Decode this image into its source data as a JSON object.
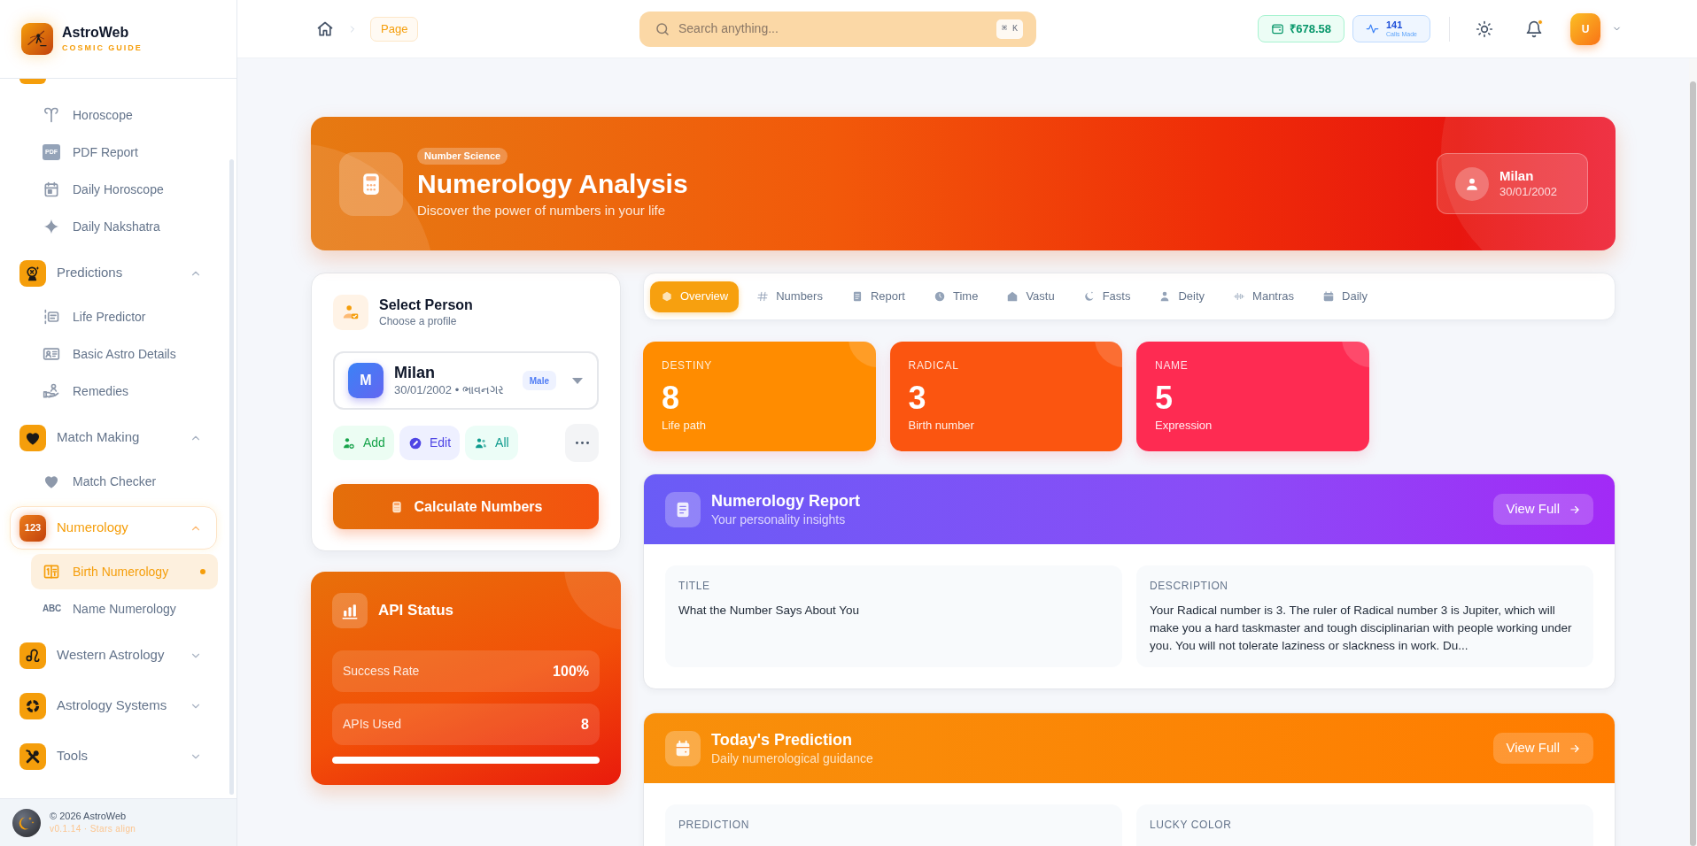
{
  "sidebar": {
    "brand": {
      "name": "AstroWeb",
      "tagline": "COSMIC GUIDE"
    },
    "groups": [
      {
        "children": [
          {
            "label": "Horoscope",
            "selected": false
          },
          {
            "label": "PDF Report",
            "icon_text": "PDF",
            "selected": false
          },
          {
            "label": "Daily Horoscope",
            "selected": false
          },
          {
            "label": "Daily Nakshatra",
            "selected": false
          }
        ]
      },
      {
        "label": "Predictions",
        "expanded": true,
        "selected": false,
        "children": [
          {
            "label": "Life Predictor",
            "selected": false
          },
          {
            "label": "Basic Astro Details",
            "selected": false
          },
          {
            "label": "Remedies",
            "selected": false
          }
        ]
      },
      {
        "label": "Match Making",
        "expanded": true,
        "selected": false,
        "children": [
          {
            "label": "Match Checker",
            "selected": false
          }
        ]
      },
      {
        "label": "Numerology",
        "icon_text": "123",
        "expanded": true,
        "selected": true,
        "children": [
          {
            "label": "Birth Numerology",
            "selected": true
          },
          {
            "label": "Name Numerology",
            "icon_text": "ABC",
            "selected": false
          }
        ]
      },
      {
        "label": "Western Astrology",
        "expanded": false,
        "selected": false
      },
      {
        "label": "Astrology Systems",
        "expanded": false,
        "selected": false
      },
      {
        "label": "Tools",
        "expanded": false,
        "selected": false
      }
    ],
    "footer": {
      "copyright": "© 2026 AstroWeb",
      "version": "v0.1.14 · Stars align"
    }
  },
  "topbar": {
    "breadcrumb": {
      "current": "Page"
    },
    "search": {
      "placeholder": "Search anything...",
      "shortcut": "⌘ K"
    },
    "wallet": {
      "balance": "₹678.58"
    },
    "calls": {
      "count": "141",
      "label": "Calls Made"
    },
    "notifications": {
      "unread": true
    },
    "user": {
      "initial": "U"
    }
  },
  "hero": {
    "badge": "Number Science",
    "title": "Numerology Analysis",
    "subtitle": "Discover the power of numbers in your life",
    "person": {
      "name": "Milan",
      "date": "30/01/2002"
    }
  },
  "select_person": {
    "title": "Select Person",
    "subtitle": "Choose a profile",
    "profile": {
      "initial": "M",
      "name": "Milan",
      "details": "30/01/2002 • ભાવનગર",
      "gender": "Male"
    },
    "actions": [
      {
        "kind": "add",
        "label": "Add"
      },
      {
        "kind": "edit",
        "label": "Edit"
      },
      {
        "kind": "all",
        "label": "All"
      }
    ],
    "primary_action": "Calculate Numbers"
  },
  "api_status": {
    "title": "API Status",
    "metrics": [
      {
        "label": "Success Rate",
        "value": "100%"
      },
      {
        "label": "APIs Used",
        "value": "8"
      }
    ],
    "level": 1
  },
  "tabs": [
    {
      "label": "Overview",
      "selected": true
    },
    {
      "label": "Numbers",
      "selected": false
    },
    {
      "label": "Report",
      "selected": false
    },
    {
      "label": "Time",
      "selected": false
    },
    {
      "label": "Vastu",
      "selected": false
    },
    {
      "label": "Fasts",
      "selected": false
    },
    {
      "label": "Deity",
      "selected": false
    },
    {
      "label": "Mantras",
      "selected": false
    },
    {
      "label": "Daily",
      "selected": false
    }
  ],
  "number_cards": [
    {
      "label": "DESTINY",
      "value": "8",
      "caption": "Life path",
      "color": "#ff8c00"
    },
    {
      "label": "RADICAL",
      "value": "3",
      "caption": "Birth number",
      "color": "#fb5510"
    },
    {
      "label": "NAME",
      "value": "5",
      "caption": "Expression",
      "color": "#fe2b52"
    }
  ],
  "report_cards": [
    {
      "kind": "report",
      "title": "Numerology Report",
      "subtitle": "Your personality insights",
      "action": "View Full",
      "fields": [
        {
          "label": "TITLE",
          "value": "What the Number Says About You"
        },
        {
          "label": "DESCRIPTION",
          "value": "Your Radical number is 3. The ruler of Radical number 3 is Jupiter, which will make you a hard taskmaster and tough disciplinarian with people working under you. You will not tolerate laziness or slackness in work. Du..."
        }
      ]
    },
    {
      "kind": "prediction",
      "title": "Today's Prediction",
      "subtitle": "Daily numerological guidance",
      "action": "View Full",
      "fields": [
        {
          "label": "PREDICTION"
        },
        {
          "label": "LUCKY COLOR"
        }
      ]
    }
  ]
}
